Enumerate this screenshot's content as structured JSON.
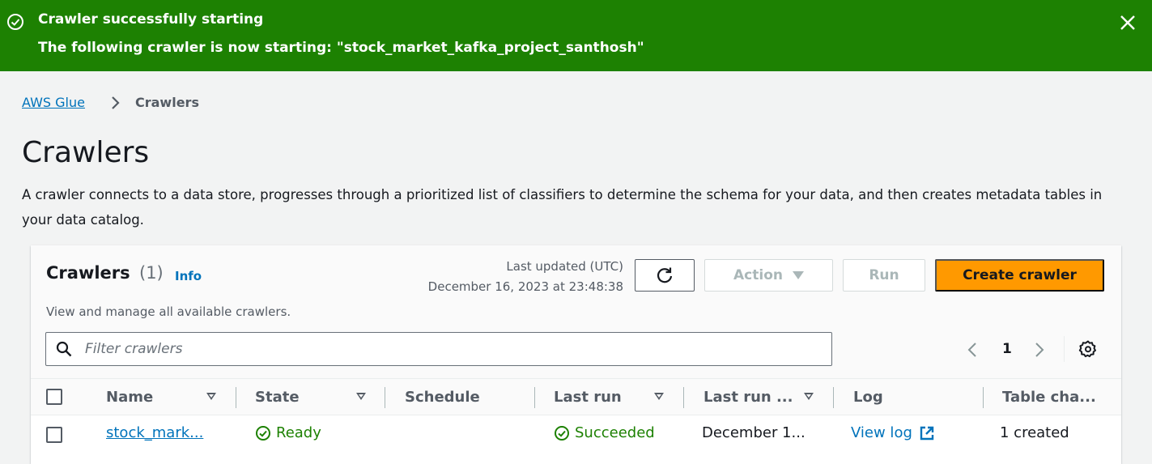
{
  "flash": {
    "title": "Crawler successfully starting",
    "message": "The following crawler is now starting: \"stock_market_kafka_project_santhosh\"",
    "color": "#1d8102"
  },
  "breadcrumb": {
    "root": "AWS Glue",
    "current": "Crawlers"
  },
  "page": {
    "title": "Crawlers",
    "description": "A crawler connects to a data store, progresses through a prioritized list of classifiers to determine the schema for your data, and then creates metadata tables in your data catalog."
  },
  "panel": {
    "title": "Crawlers",
    "count": "(1)",
    "info": "Info",
    "subtitle": "View and manage all available crawlers.",
    "updated_label": "Last updated (UTC)",
    "updated_time": "December 16, 2023 at 23:48:38",
    "action_label": "Action",
    "run_label": "Run",
    "create_label": "Create crawler",
    "accent": "#ff9900"
  },
  "search": {
    "placeholder": "Filter crawlers",
    "value": ""
  },
  "pagination": {
    "current": "1"
  },
  "table": {
    "headers": {
      "name": "Name",
      "state": "State",
      "schedule": "Schedule",
      "last_run": "Last run",
      "last_run_ts": "Last run ...",
      "log": "Log",
      "table_changes": "Table cha..."
    },
    "rows": [
      {
        "name": "stock_mark...",
        "state": "Ready",
        "schedule": "",
        "last_run": "Succeeded",
        "last_run_ts": "December 1...",
        "log": "View log",
        "table_changes": "1 created"
      }
    ]
  },
  "icons": {
    "flash": "check-circle-icon",
    "close": "close-icon",
    "refresh": "refresh-icon",
    "search": "search-icon",
    "settings": "gear-icon",
    "external": "external-link-icon"
  }
}
